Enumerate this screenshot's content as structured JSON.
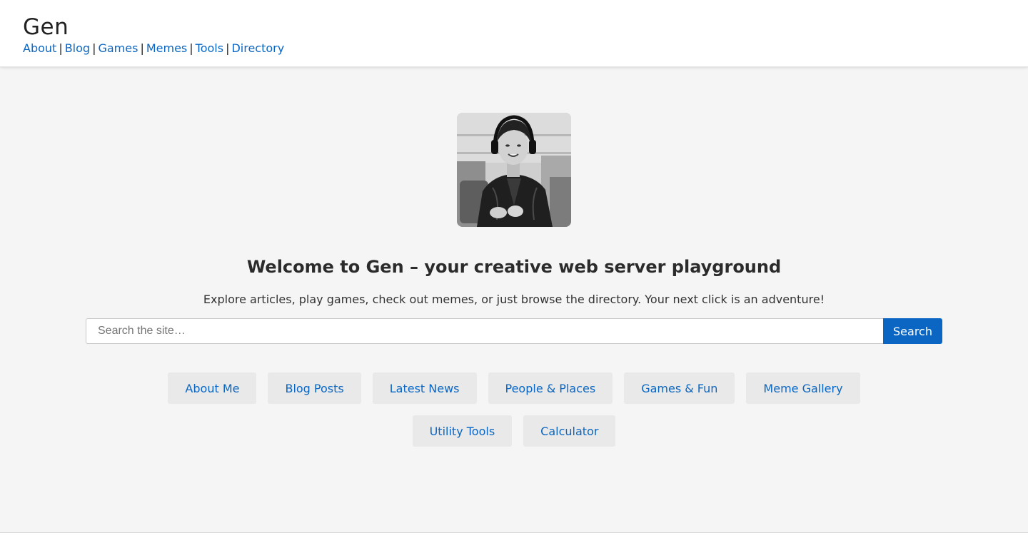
{
  "header": {
    "site_title": "Gen",
    "nav": [
      {
        "label": "About"
      },
      {
        "label": "Blog"
      },
      {
        "label": "Games"
      },
      {
        "label": "Memes"
      },
      {
        "label": "Tools"
      },
      {
        "label": "Directory"
      }
    ],
    "separator": "|"
  },
  "hero": {
    "avatar_icon": "profile-photo",
    "title": "Welcome to Gen – your creative web server playground",
    "subtitle": "Explore articles, play games, check out memes, or just browse the directory. Your next click is an adventure!"
  },
  "search": {
    "placeholder": "Search the site…",
    "value": "",
    "button_label": "Search"
  },
  "quick_links": [
    {
      "label": "About Me"
    },
    {
      "label": "Blog Posts"
    },
    {
      "label": "Latest News"
    },
    {
      "label": "People & Places"
    },
    {
      "label": "Games & Fun"
    },
    {
      "label": "Meme Gallery"
    },
    {
      "label": "Utility Tools"
    },
    {
      "label": "Calculator"
    }
  ],
  "colors": {
    "link": "#0a66c2",
    "accent_button": "#0a66c2",
    "page_background": "#f5f5f5",
    "header_background": "#ffffff",
    "chip_background": "#e9e9e9"
  }
}
